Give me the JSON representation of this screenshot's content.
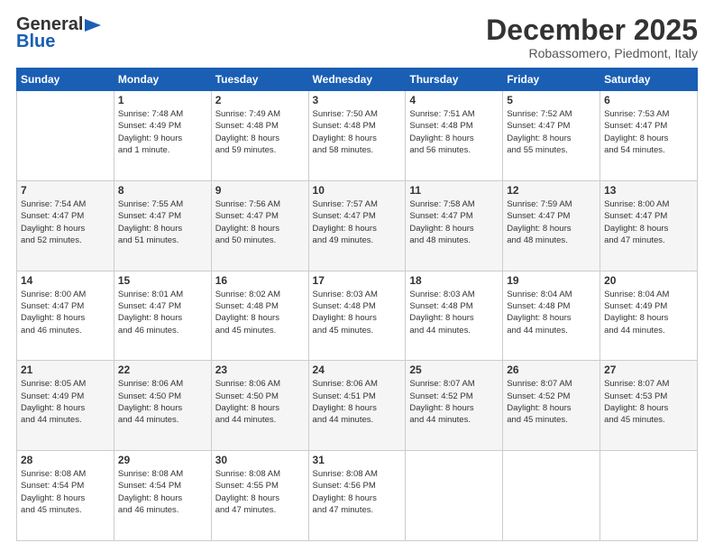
{
  "header": {
    "logo_general": "General",
    "logo_blue": "Blue",
    "month": "December 2025",
    "location": "Robassomero, Piedmont, Italy"
  },
  "days_of_week": [
    "Sunday",
    "Monday",
    "Tuesday",
    "Wednesday",
    "Thursday",
    "Friday",
    "Saturday"
  ],
  "weeks": [
    [
      {
        "day": "",
        "info": ""
      },
      {
        "day": "1",
        "info": "Sunrise: 7:48 AM\nSunset: 4:49 PM\nDaylight: 9 hours\nand 1 minute."
      },
      {
        "day": "2",
        "info": "Sunrise: 7:49 AM\nSunset: 4:48 PM\nDaylight: 8 hours\nand 59 minutes."
      },
      {
        "day": "3",
        "info": "Sunrise: 7:50 AM\nSunset: 4:48 PM\nDaylight: 8 hours\nand 58 minutes."
      },
      {
        "day": "4",
        "info": "Sunrise: 7:51 AM\nSunset: 4:48 PM\nDaylight: 8 hours\nand 56 minutes."
      },
      {
        "day": "5",
        "info": "Sunrise: 7:52 AM\nSunset: 4:47 PM\nDaylight: 8 hours\nand 55 minutes."
      },
      {
        "day": "6",
        "info": "Sunrise: 7:53 AM\nSunset: 4:47 PM\nDaylight: 8 hours\nand 54 minutes."
      }
    ],
    [
      {
        "day": "7",
        "info": "Sunrise: 7:54 AM\nSunset: 4:47 PM\nDaylight: 8 hours\nand 52 minutes."
      },
      {
        "day": "8",
        "info": "Sunrise: 7:55 AM\nSunset: 4:47 PM\nDaylight: 8 hours\nand 51 minutes."
      },
      {
        "day": "9",
        "info": "Sunrise: 7:56 AM\nSunset: 4:47 PM\nDaylight: 8 hours\nand 50 minutes."
      },
      {
        "day": "10",
        "info": "Sunrise: 7:57 AM\nSunset: 4:47 PM\nDaylight: 8 hours\nand 49 minutes."
      },
      {
        "day": "11",
        "info": "Sunrise: 7:58 AM\nSunset: 4:47 PM\nDaylight: 8 hours\nand 48 minutes."
      },
      {
        "day": "12",
        "info": "Sunrise: 7:59 AM\nSunset: 4:47 PM\nDaylight: 8 hours\nand 48 minutes."
      },
      {
        "day": "13",
        "info": "Sunrise: 8:00 AM\nSunset: 4:47 PM\nDaylight: 8 hours\nand 47 minutes."
      }
    ],
    [
      {
        "day": "14",
        "info": "Sunrise: 8:00 AM\nSunset: 4:47 PM\nDaylight: 8 hours\nand 46 minutes."
      },
      {
        "day": "15",
        "info": "Sunrise: 8:01 AM\nSunset: 4:47 PM\nDaylight: 8 hours\nand 46 minutes."
      },
      {
        "day": "16",
        "info": "Sunrise: 8:02 AM\nSunset: 4:48 PM\nDaylight: 8 hours\nand 45 minutes."
      },
      {
        "day": "17",
        "info": "Sunrise: 8:03 AM\nSunset: 4:48 PM\nDaylight: 8 hours\nand 45 minutes."
      },
      {
        "day": "18",
        "info": "Sunrise: 8:03 AM\nSunset: 4:48 PM\nDaylight: 8 hours\nand 44 minutes."
      },
      {
        "day": "19",
        "info": "Sunrise: 8:04 AM\nSunset: 4:48 PM\nDaylight: 8 hours\nand 44 minutes."
      },
      {
        "day": "20",
        "info": "Sunrise: 8:04 AM\nSunset: 4:49 PM\nDaylight: 8 hours\nand 44 minutes."
      }
    ],
    [
      {
        "day": "21",
        "info": "Sunrise: 8:05 AM\nSunset: 4:49 PM\nDaylight: 8 hours\nand 44 minutes."
      },
      {
        "day": "22",
        "info": "Sunrise: 8:06 AM\nSunset: 4:50 PM\nDaylight: 8 hours\nand 44 minutes."
      },
      {
        "day": "23",
        "info": "Sunrise: 8:06 AM\nSunset: 4:50 PM\nDaylight: 8 hours\nand 44 minutes."
      },
      {
        "day": "24",
        "info": "Sunrise: 8:06 AM\nSunset: 4:51 PM\nDaylight: 8 hours\nand 44 minutes."
      },
      {
        "day": "25",
        "info": "Sunrise: 8:07 AM\nSunset: 4:52 PM\nDaylight: 8 hours\nand 44 minutes."
      },
      {
        "day": "26",
        "info": "Sunrise: 8:07 AM\nSunset: 4:52 PM\nDaylight: 8 hours\nand 45 minutes."
      },
      {
        "day": "27",
        "info": "Sunrise: 8:07 AM\nSunset: 4:53 PM\nDaylight: 8 hours\nand 45 minutes."
      }
    ],
    [
      {
        "day": "28",
        "info": "Sunrise: 8:08 AM\nSunset: 4:54 PM\nDaylight: 8 hours\nand 45 minutes."
      },
      {
        "day": "29",
        "info": "Sunrise: 8:08 AM\nSunset: 4:54 PM\nDaylight: 8 hours\nand 46 minutes."
      },
      {
        "day": "30",
        "info": "Sunrise: 8:08 AM\nSunset: 4:55 PM\nDaylight: 8 hours\nand 47 minutes."
      },
      {
        "day": "31",
        "info": "Sunrise: 8:08 AM\nSunset: 4:56 PM\nDaylight: 8 hours\nand 47 minutes."
      },
      {
        "day": "",
        "info": ""
      },
      {
        "day": "",
        "info": ""
      },
      {
        "day": "",
        "info": ""
      }
    ]
  ]
}
